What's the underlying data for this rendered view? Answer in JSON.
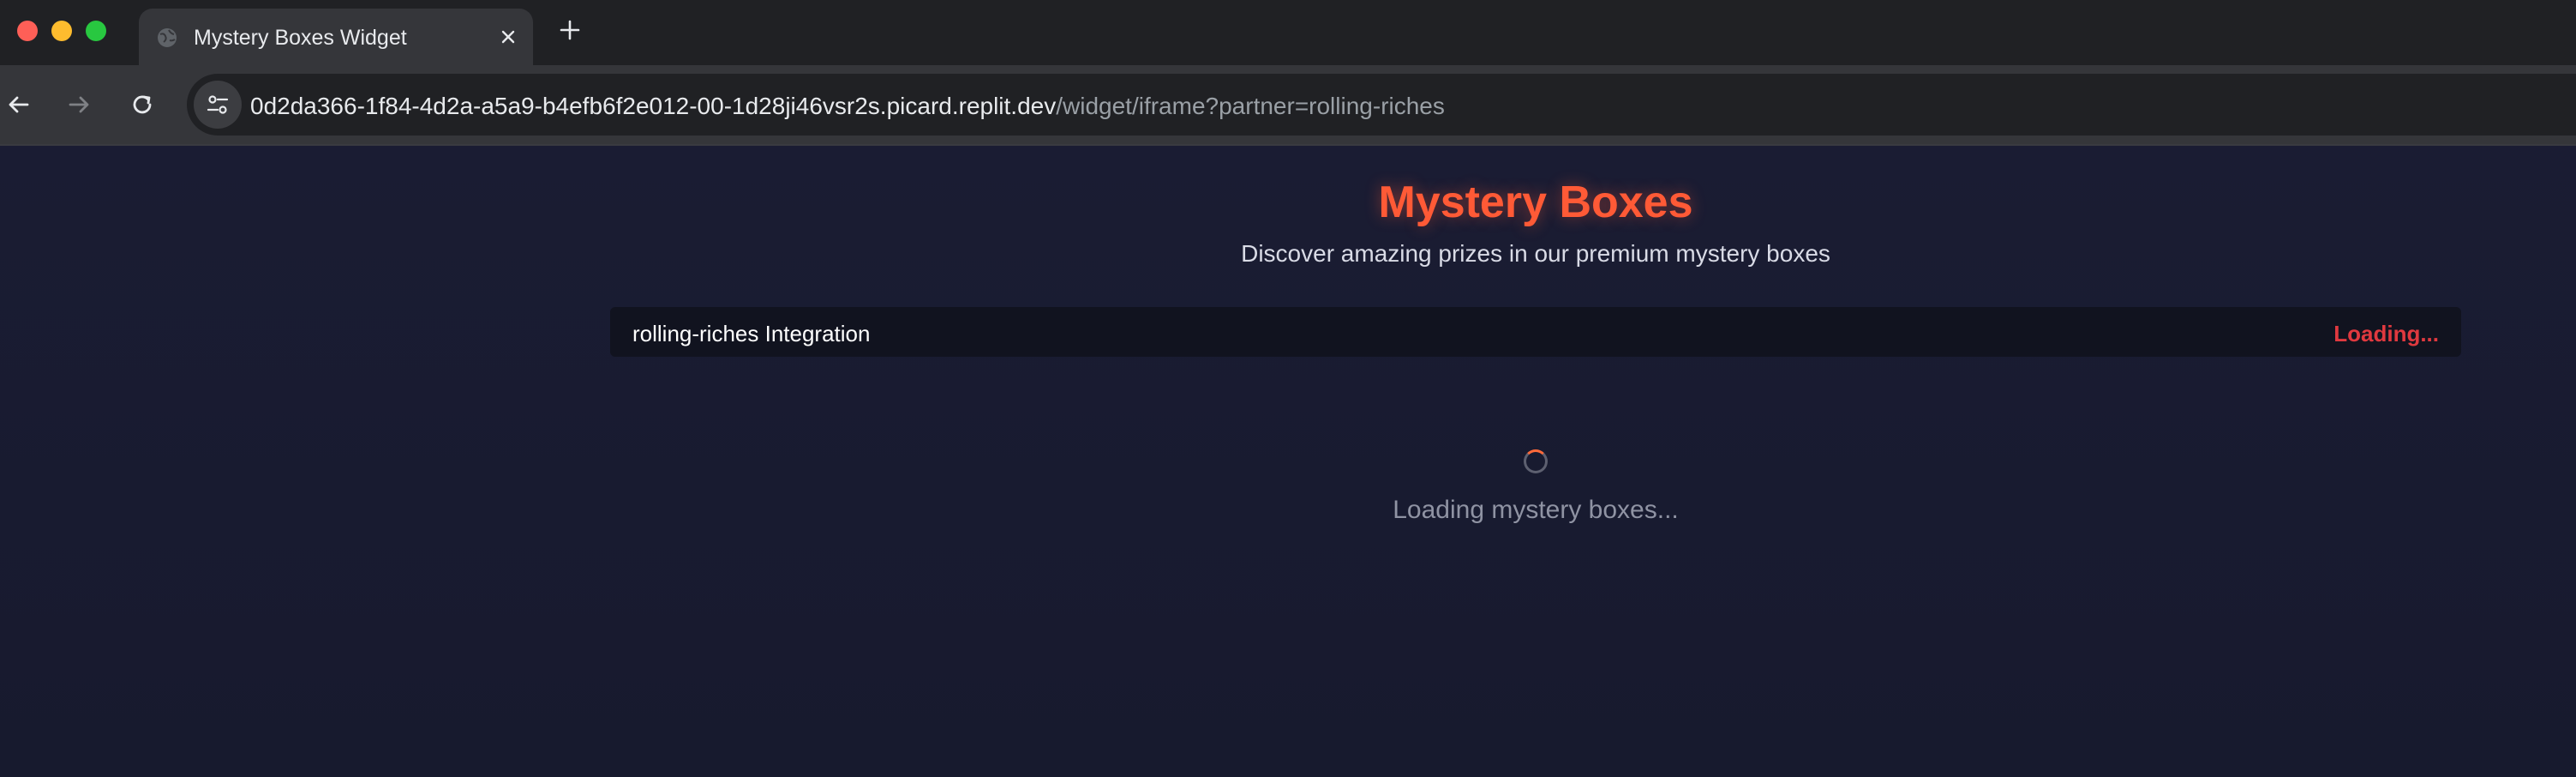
{
  "browser": {
    "tab": {
      "title": "Mystery Boxes Widget",
      "icon": "globe-icon"
    },
    "url": {
      "host": "0d2da366-1f84-4d2a-a5a9-b4efb6f2e012-00-1d28ji46vsr2s.picard.replit.dev",
      "path": "/widget/iframe?partner=rolling-riches"
    },
    "colors": {
      "close": "#fe5f57",
      "minimize": "#febc2e",
      "zoom": "#28c840"
    }
  },
  "page": {
    "title": "Mystery Boxes",
    "subtitle": "Discover amazing prizes in our premium mystery boxes",
    "integration": {
      "label": "rolling-riches Integration",
      "status": "Loading..."
    },
    "loading_text": "Loading mystery boxes...",
    "colors": {
      "accent": "#ff5a36",
      "status": "#e0393f",
      "background": "#1a1c31"
    }
  }
}
